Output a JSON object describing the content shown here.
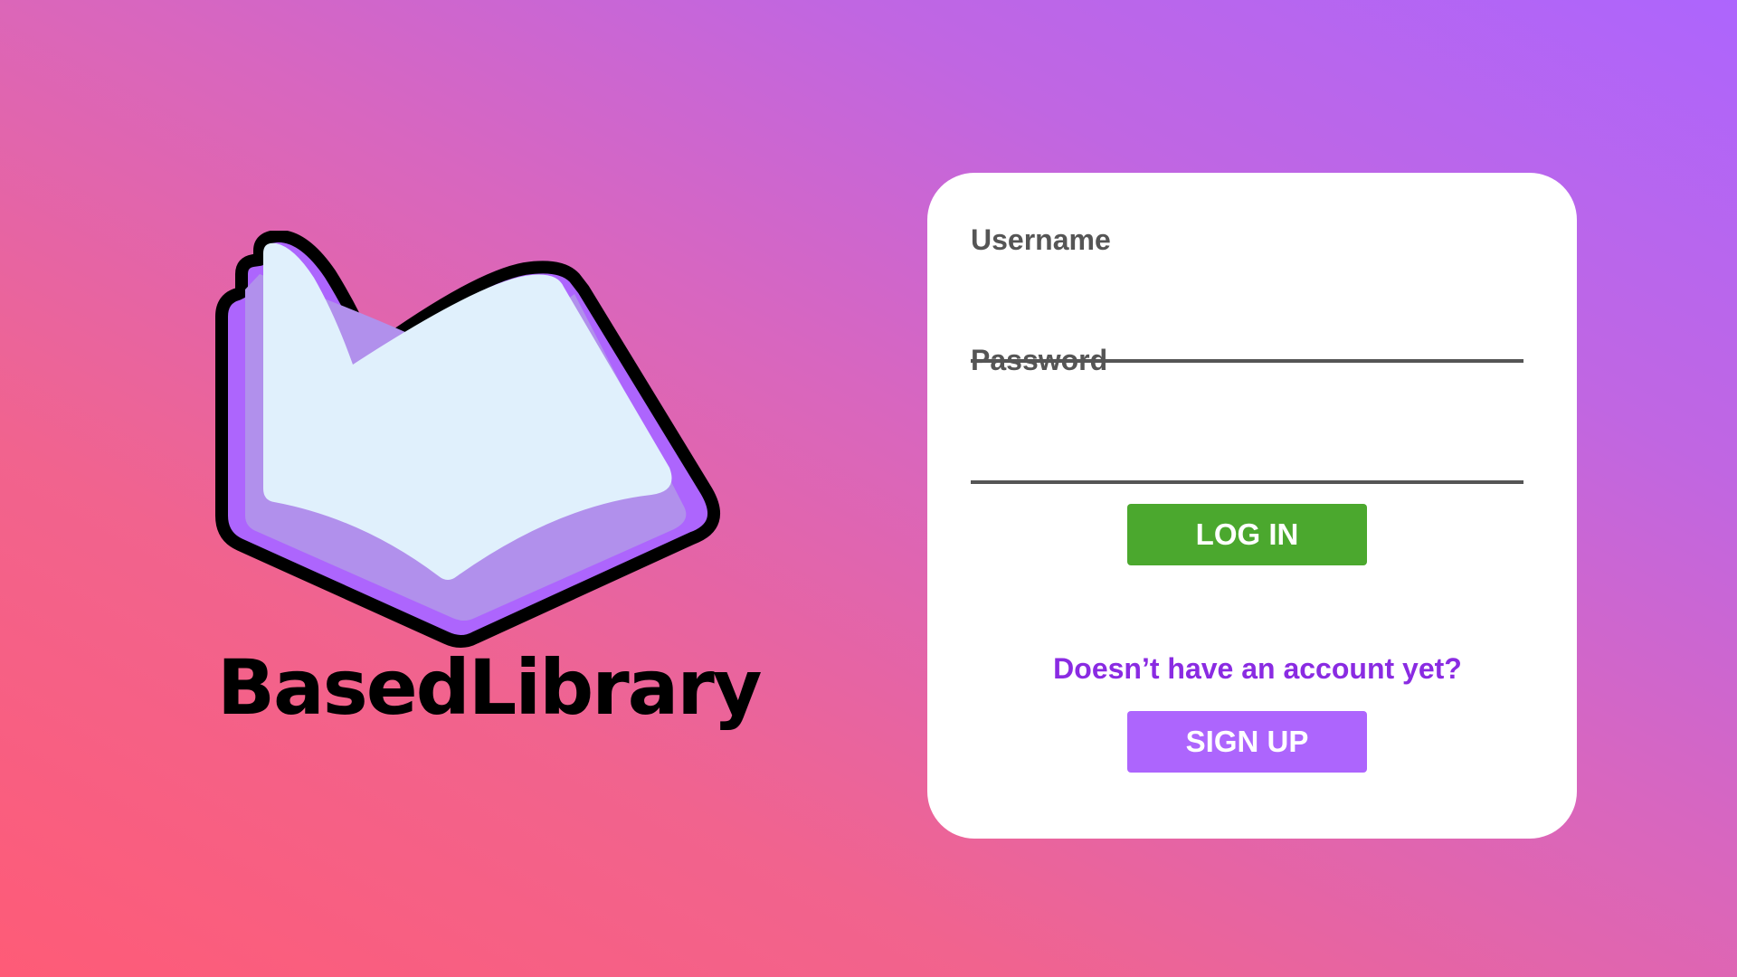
{
  "brand": {
    "name": "BasedLibrary",
    "logo_icon": "open-book-icon"
  },
  "login_form": {
    "username_label": "Username",
    "username_value": "",
    "password_label": "Password",
    "password_value": "",
    "login_button_label": "LOG IN",
    "signup_prompt": "Doesn’t have an account yet?",
    "signup_button_label": "SIGN UP"
  },
  "colors": {
    "background_gradient": [
      "#fe5b77",
      "#ad65fd"
    ],
    "card_background": "#ffffff",
    "label_text": "#555555",
    "login_button": "#4ba82e",
    "signup_button": "#ad65fd",
    "signup_prompt_text": "#8a2be2",
    "logo_page": "#e0f0fc",
    "logo_cover": "#ad65fd",
    "logo_inner_page": "#b190ec"
  }
}
